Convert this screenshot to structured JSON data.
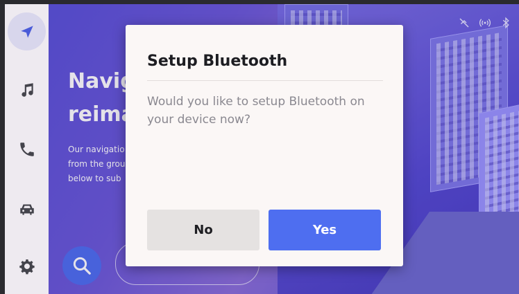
{
  "hero": {
    "title_line1": "Navig",
    "title_line2": "reima",
    "desc_line1": "Our navigatio",
    "desc_line2": "from the grou",
    "desc_line3": "below to sub"
  },
  "sidebar": {
    "items": [
      {
        "icon": "navigation-arrow-icon",
        "active": true
      },
      {
        "icon": "music-note-icon",
        "active": false
      },
      {
        "icon": "phone-icon",
        "active": false
      },
      {
        "icon": "car-icon",
        "active": false
      },
      {
        "icon": "gear-icon",
        "active": false
      }
    ]
  },
  "status_icons": [
    "gps-off-icon",
    "signal-icon",
    "bluetooth-icon"
  ],
  "dialog": {
    "title": "Setup Bluetooth",
    "message": "Would you like to setup Bluetooth on your device now?",
    "no_label": "No",
    "yes_label": "Yes"
  },
  "colors": {
    "accent": "#4e6ef0",
    "sidebar_bg": "#eeeaf0",
    "dialog_bg": "#fbf7f6"
  }
}
